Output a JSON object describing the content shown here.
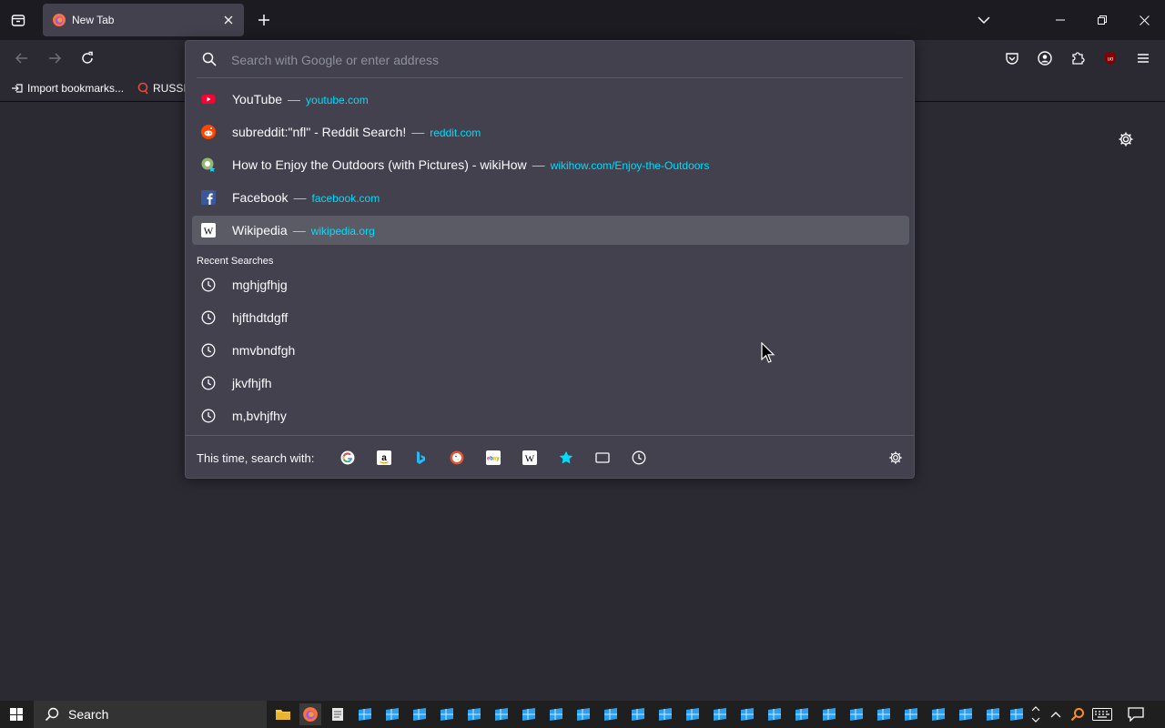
{
  "tabstrip": {
    "tab_title": "New Tab"
  },
  "urlbar": {
    "placeholder": "Search with Google or enter address",
    "suggestions": [
      {
        "title": "YouTube",
        "sep": "—",
        "url": "youtube.com",
        "icon": "youtube-icon"
      },
      {
        "title": "subreddit:\"nfl\" - Reddit Search!",
        "sep": "—",
        "url": "reddit.com",
        "icon": "reddit-icon"
      },
      {
        "title": "How to Enjoy the Outdoors (with Pictures) - wikiHow",
        "sep": "—",
        "url": "wikihow.com/Enjoy-the-Outdoors",
        "icon": "wikihow-icon"
      },
      {
        "title": "Facebook",
        "sep": "—",
        "url": "facebook.com",
        "icon": "facebook-icon"
      },
      {
        "title": "Wikipedia",
        "sep": "—",
        "url": "wikipedia.org",
        "icon": "wikipedia-icon"
      }
    ],
    "recent_header": "Recent Searches",
    "recent": [
      "mghjgfhjg",
      "hjfthdtdgff",
      "nmvbndfgh",
      "jkvfhjfh",
      "m,bvhjfhy"
    ],
    "oneoff_label": "This time, search with:",
    "engines": [
      "google",
      "amazon",
      "bing",
      "duckduckgo",
      "ebay",
      "wikipedia",
      "bookmarks",
      "tabs",
      "history"
    ]
  },
  "bookmarks": {
    "import_label": "Import bookmarks...",
    "item2_label": "RUSSIA"
  },
  "taskbar": {
    "search_label": "Search"
  },
  "colors": {
    "url_link": "#00ddff",
    "popup_bg": "#42414d",
    "selected_row": "#5b5b66"
  }
}
